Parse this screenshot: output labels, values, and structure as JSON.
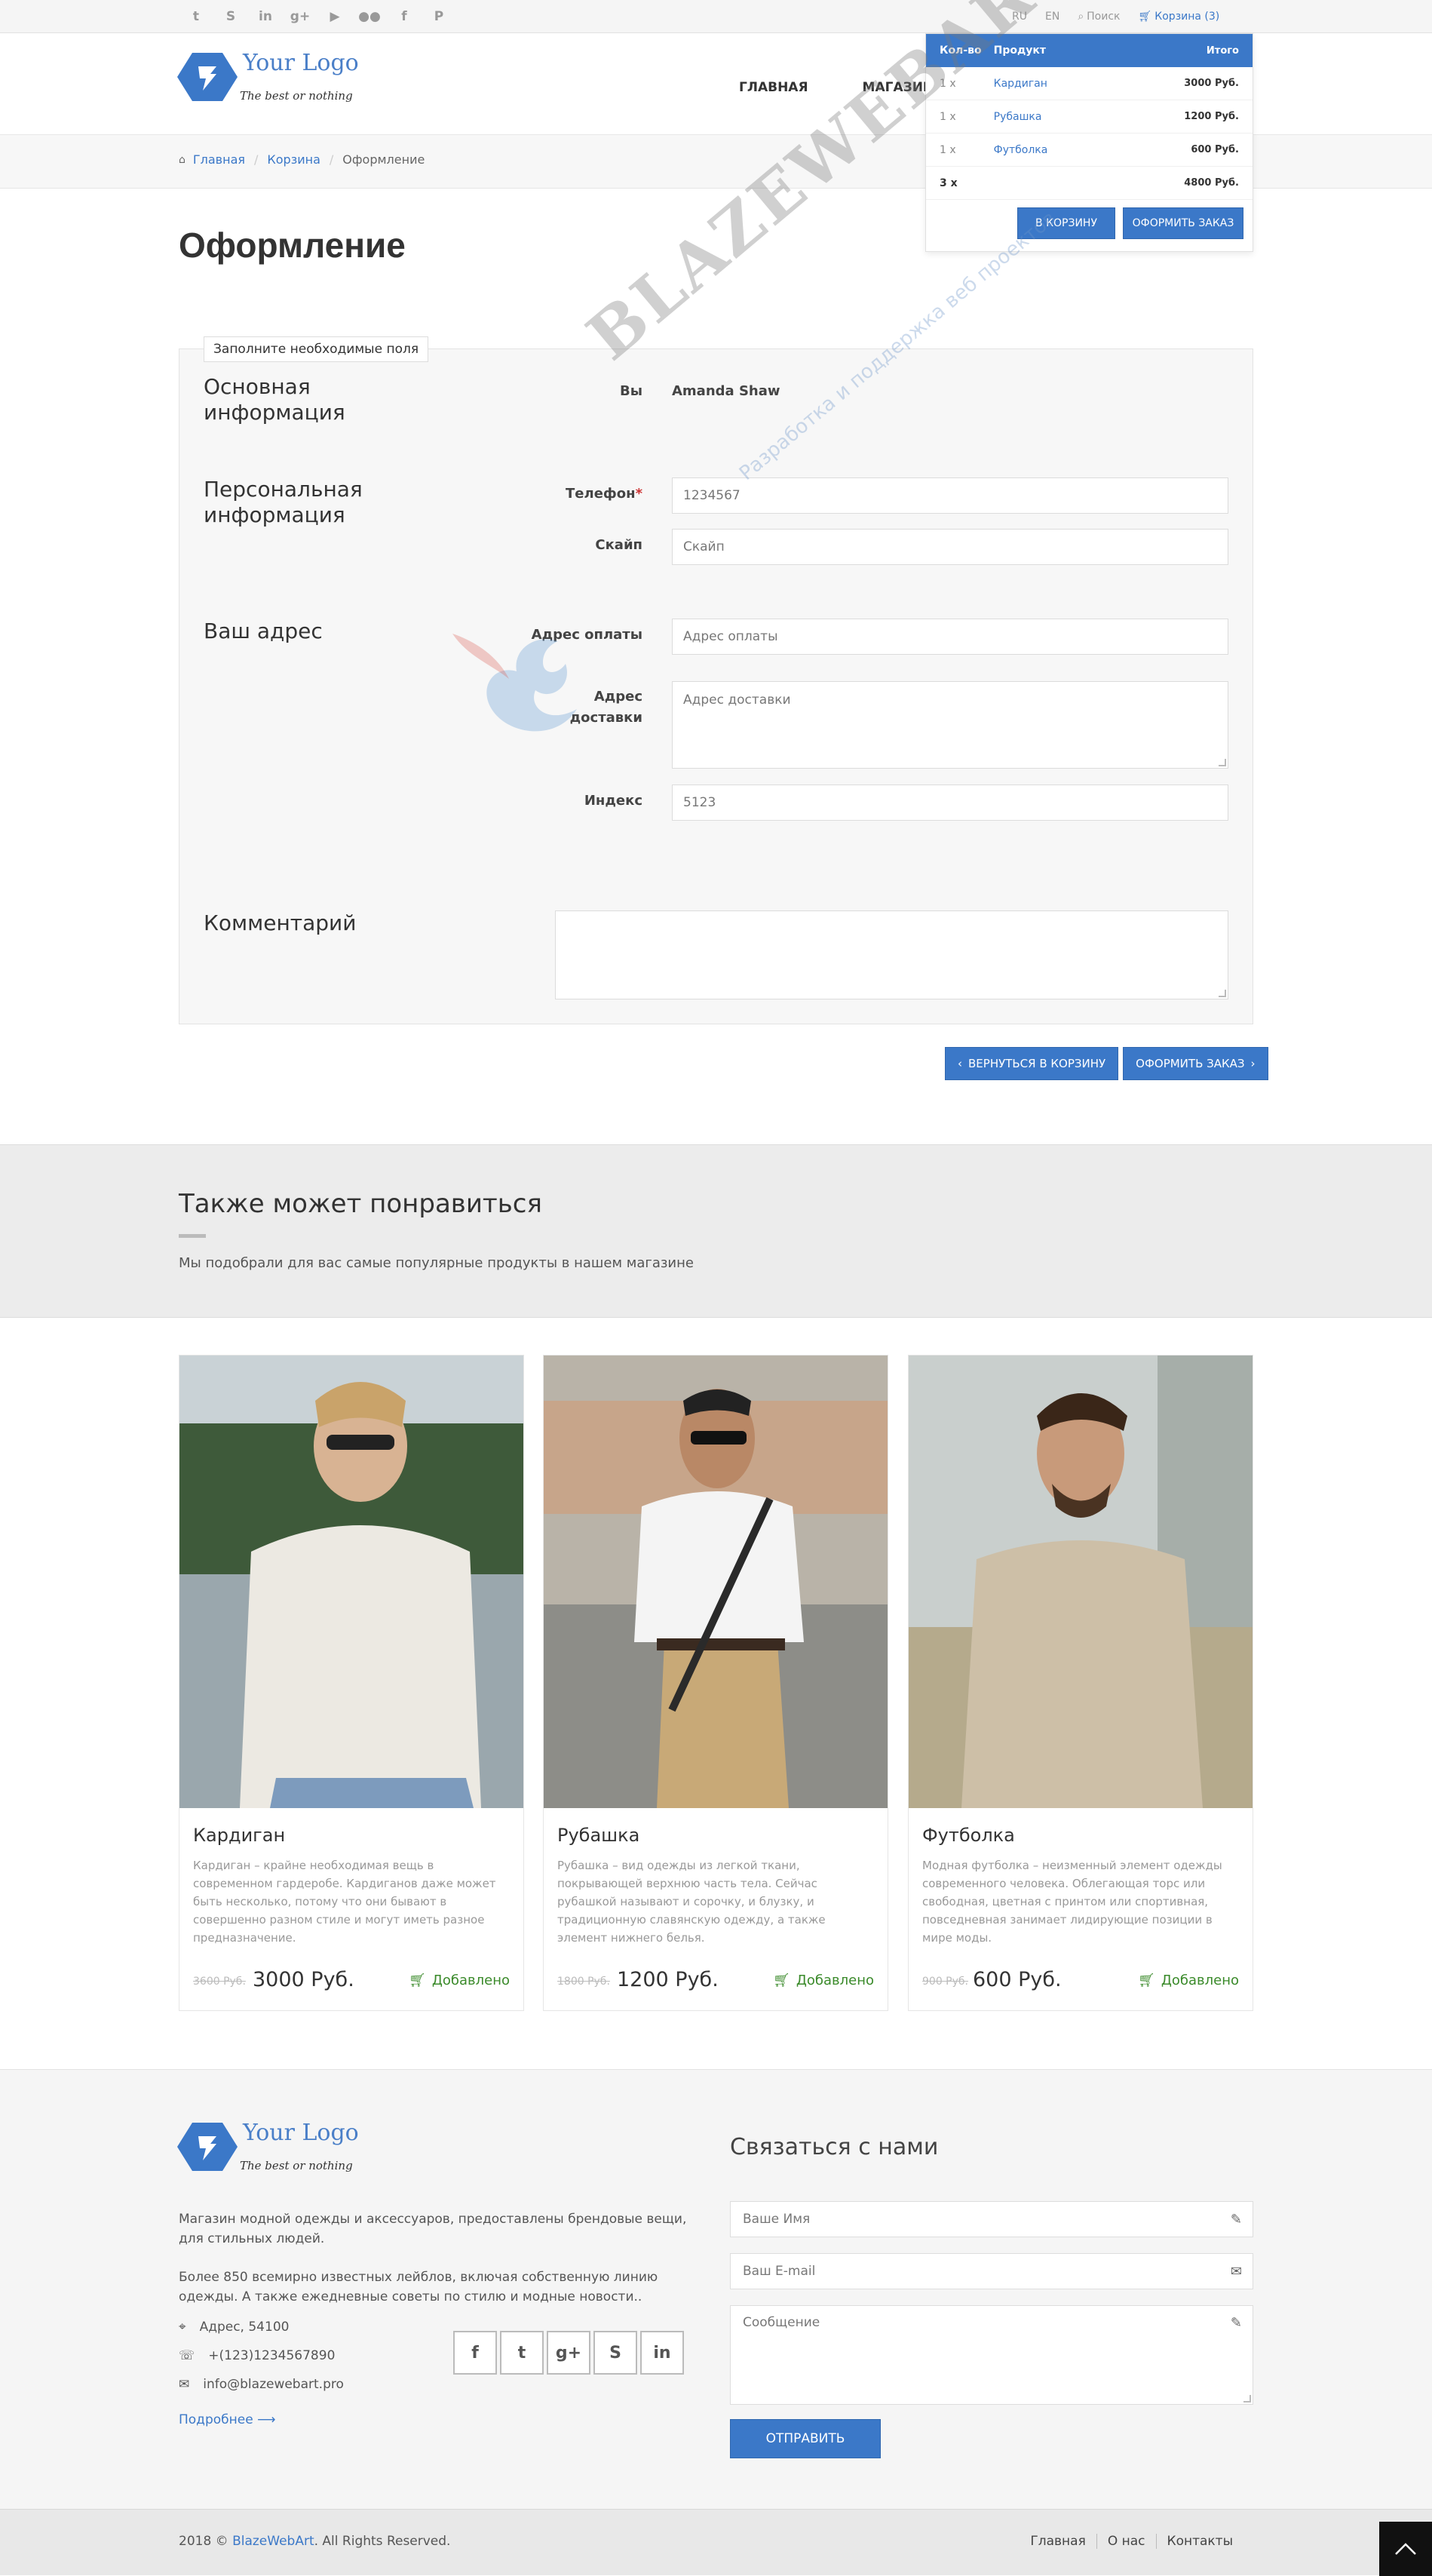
{
  "topbar": {
    "social_icons": [
      "twitter-icon",
      "skype-icon",
      "linkedin-icon",
      "google-plus-icon",
      "youtube-icon",
      "flickr-icon",
      "facebook-icon",
      "pinterest-icon"
    ],
    "lang_ru": "RU",
    "lang_en": "EN",
    "search": "Поиск",
    "cart": "Корзина (3)"
  },
  "header": {
    "logo_text": "Your Logo",
    "logo_tagline": "The best or nothing",
    "nav": [
      "ГЛАВНАЯ",
      "МАГАЗИН"
    ]
  },
  "cart_dropdown": {
    "headers": [
      "Кол-во",
      "Продукт",
      "Итого"
    ],
    "items": [
      {
        "qty": "1 x",
        "product": "Кардиган",
        "total": "3000 Руб."
      },
      {
        "qty": "1 x",
        "product": "Рубашка",
        "total": "1200 Руб."
      },
      {
        "qty": "1 x",
        "product": "Футболка",
        "total": "600 Руб."
      }
    ],
    "summary": {
      "qty": "3 x",
      "total": "4800 Руб."
    },
    "to_cart": "В КОРЗИНУ",
    "checkout": "ОФОРМИТЬ ЗАКАЗ"
  },
  "breadcrumb": [
    "Главная",
    "Корзина",
    "Оформление"
  ],
  "page_title": "Оформление",
  "form": {
    "legend": "Заполните необходимые поля",
    "sections": {
      "basic": "Основная информация",
      "personal": "Персональная информация",
      "address": "Ваш адрес",
      "comment": "Комментарий"
    },
    "you_label": "Вы",
    "you_value": "Amanda Shaw",
    "phone_label": "Телефон",
    "phone_required": "*",
    "phone_value": "1234567",
    "skype_label": "Скайп",
    "skype_placeholder": "Скайп",
    "billing_label": "Адрес оплаты",
    "billing_placeholder": "Адрес оплаты",
    "shipping_label": "Адрес доставки",
    "shipping_placeholder": "Адрес доставки",
    "zip_label": "Индекс",
    "zip_value": "5123",
    "back_button": "ВЕРНУТЬСЯ В КОРЗИНУ",
    "submit_button": "ОФОРМИТЬ ЗАКАЗ"
  },
  "watermark": {
    "title": "BLAZEWEBART",
    "subtitle": "Разработка и поддержка веб проектов"
  },
  "also_like": {
    "title": "Также может понравиться",
    "subtitle": "Мы подобрали для вас самые популярные продукты в нашем магазине"
  },
  "products": [
    {
      "name": "Кардиган",
      "desc": "Кардиган – крайне необходимая вещь в современном гардеробе. Кардиганов даже может быть несколько, потому что они бывают в совершенно разном стиле и могут иметь разное предназначение.",
      "old_price": "3600 Руб.",
      "price": "3000 Руб.",
      "status": "Добавлено"
    },
    {
      "name": "Рубашка",
      "desc": "Рубашка – вид одежды из легкой ткани, покрывающей верхнюю часть тела. Сейчас рубашкой называют и сорочку, и блузку, и традиционную славянскую одежду, а также элемент нижнего белья.",
      "old_price": "1800 Руб.",
      "price": "1200 Руб.",
      "status": "Добавлено"
    },
    {
      "name": "Футболка",
      "desc": "Модная футболка – неизменный элемент одежды современного человека. Облегающая торс или свободная, цветная с принтом или спортивная, повседневная занимает лидирующие позиции в мире моды.",
      "old_price": "900 Руб.",
      "price": "600 Руб.",
      "status": "Добавлено"
    }
  ],
  "footer": {
    "about1": "Магазин модной одежды и аксессуаров, предоставлены брендовые вещи, для стильных людей.",
    "about2": "Более 850 всемирно известных лейблов, включая собственную линию одежды. А также ежедневные советы по стилю и модные новости..",
    "address": "Адрес, 54100",
    "phone": "+(123)1234567890",
    "email": "info@blazewebart.pro",
    "more": "Подробнее",
    "social": [
      "facebook-icon",
      "twitter-icon",
      "google-plus-icon",
      "skype-icon",
      "linkedin-icon"
    ],
    "contact_title": "Связаться с нами",
    "name_placeholder": "Ваше Имя",
    "email_placeholder": "Ваш E-mail",
    "message_placeholder": "Сообщение",
    "send": "ОТПРАВИТЬ"
  },
  "bottom": {
    "copy_prefix": "2018 © ",
    "brand": "BlazeWebArt",
    "copy_suffix": ". All Rights Reserved.",
    "links": [
      "Главная",
      "О нас",
      "Контакты"
    ]
  },
  "colors": {
    "accent": "#3b78c8",
    "added": "#3a8a2a"
  }
}
